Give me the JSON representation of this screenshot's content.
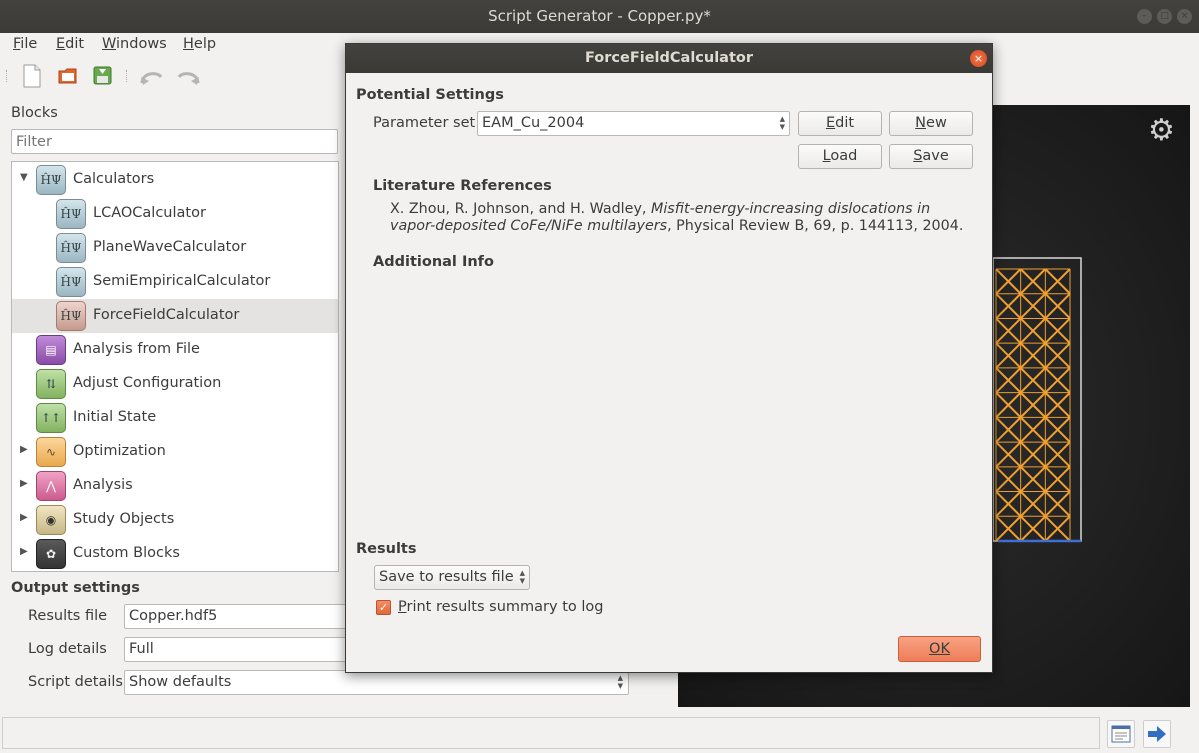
{
  "window": {
    "title": "Script Generator - Copper.py*"
  },
  "menu": [
    "File",
    "Edit",
    "Windows",
    "Help"
  ],
  "toolbar": {
    "icons": [
      "new-file-icon",
      "open-folder-icon",
      "save-icon",
      "undo-icon",
      "redo-icon"
    ]
  },
  "blocks": {
    "heading": "Blocks",
    "filter_placeholder": "Filter",
    "tree": {
      "calculators": "Calculators",
      "lcao": "LCAOCalculator",
      "planewave": "PlaneWaveCalculator",
      "semiempirical": "SemiEmpiricalCalculator",
      "forcefield": "ForceFieldCalculator",
      "analysis_file": "Analysis from File",
      "adjust": "Adjust Configuration",
      "initial": "Initial State",
      "optimization": "Optimization",
      "analysis": "Analysis",
      "study": "Study Objects",
      "custom": "Custom Blocks"
    },
    "icon_glyph": "ĤΨ"
  },
  "output": {
    "heading": "Output settings",
    "results_label": "Results file",
    "results_value": "Copper.hdf5",
    "log_label": "Log details",
    "log_value": "Full",
    "script_label": "Script details",
    "script_value": "Show defaults"
  },
  "dialog": {
    "title": "ForceFieldCalculator",
    "potential_heading": "Potential Settings",
    "param_label": "Parameter set",
    "param_value": "EAM_Cu_2004",
    "edit_label": "Edit",
    "new_label": "New",
    "load_label": "Load",
    "save_label": "Save",
    "lit_heading": "Literature References",
    "ref_authors": "X. Zhou, R. Johnson, and H. Wadley, ",
    "ref_title": "Misfit-energy-increasing dislocations in vapor-deposited CoFe/NiFe multilayers",
    "ref_rest": ", Physical Review B, 69, p. 144113, 2004.",
    "addl_heading": "Additional Info",
    "results_heading": "Results",
    "results_combo": "Save to results file",
    "print_summary": "Print results summary to log",
    "print_summary_checked": true,
    "ok_label": "OK"
  },
  "colors": {
    "accent": "#ee7e58",
    "titlebar": "#3b3a37",
    "lattice": "#f0a030"
  }
}
